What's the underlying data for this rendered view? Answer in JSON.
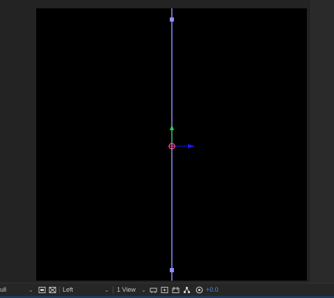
{
  "viewer": {
    "resolution_value": "ull",
    "view_angle": "Left",
    "view_layout": "1 View",
    "exposure": "+0.0"
  },
  "colors": {
    "layer_line": "#8d8dff",
    "y_axis": "#2bd14a",
    "x_axis": "#1a1aff",
    "anchor": "#ff5aa0",
    "exposure_text": "#4a90e2"
  },
  "icons": [
    "resolution-dropdown-chevron",
    "snapshot-icon",
    "transparency-grid-icon",
    "view-dropdown-chevron",
    "layout-dropdown-chevron",
    "pixel-aspect-icon",
    "fast-previews-icon",
    "timeline-icon",
    "flowchart-icon",
    "reset-exposure-icon"
  ]
}
